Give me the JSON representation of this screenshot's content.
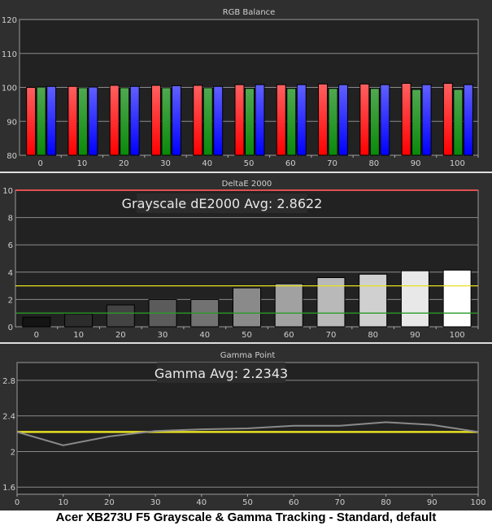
{
  "caption": "Acer XB273U F5 Grayscale & Gamma Tracking - Standard, default",
  "chart_data": [
    {
      "type": "bar",
      "title": "RGB Balance",
      "categories": [
        "0",
        "10",
        "20",
        "30",
        "40",
        "50",
        "60",
        "70",
        "80",
        "90",
        "100"
      ],
      "ylim": [
        80,
        120
      ],
      "yticks": [
        "80",
        "90",
        "100",
        "110",
        "120"
      ],
      "series": [
        {
          "name": "Red",
          "color": "#ff2020",
          "values": [
            100.0,
            100.3,
            100.6,
            100.6,
            100.6,
            100.8,
            100.8,
            101.0,
            101.0,
            101.2,
            101.2
          ]
        },
        {
          "name": "Green",
          "color": "#1a9a1a",
          "values": [
            100.1,
            99.9,
            99.9,
            99.9,
            99.9,
            99.7,
            99.7,
            99.7,
            99.7,
            99.4,
            99.4
          ]
        },
        {
          "name": "Blue",
          "color": "#2020ff",
          "values": [
            100.3,
            100.1,
            100.3,
            100.5,
            100.3,
            100.8,
            100.8,
            100.8,
            100.8,
            100.8,
            100.8
          ]
        }
      ]
    },
    {
      "type": "bar",
      "title": "DeltaE 2000",
      "annotation": "Grayscale dE2000 Avg: 2.8622",
      "categories": [
        "0",
        "10",
        "20",
        "30",
        "40",
        "50",
        "60",
        "70",
        "80",
        "90",
        "100"
      ],
      "ylim": [
        0,
        10
      ],
      "yticks": [
        "0",
        "2",
        "4",
        "6",
        "8",
        "10"
      ],
      "values": [
        0.7,
        0.95,
        1.6,
        2.0,
        2.0,
        2.85,
        3.15,
        3.6,
        3.85,
        4.1,
        4.15
      ],
      "thresholds": [
        {
          "value": 10,
          "color": "#e05050"
        },
        {
          "value": 3,
          "color": "#e8e020"
        },
        {
          "value": 1,
          "color": "#2a9a2a"
        }
      ]
    },
    {
      "type": "line",
      "title": "Gamma Point",
      "annotation": "Gamma Avg: 2.2343",
      "x": [
        0,
        10,
        20,
        30,
        40,
        50,
        60,
        70,
        80,
        90,
        100
      ],
      "xticks": [
        "0",
        "10",
        "20",
        "30",
        "40",
        "50",
        "60",
        "70",
        "80",
        "90",
        "100"
      ],
      "values": [
        2.22,
        2.07,
        2.17,
        2.23,
        2.25,
        2.26,
        2.29,
        2.29,
        2.33,
        2.3,
        2.22
      ],
      "target": 2.22,
      "ylim": [
        1.52,
        3.0
      ],
      "yticks": [
        "1.6",
        "2",
        "2.4",
        "2.8"
      ],
      "ytick_values": [
        1.6,
        2.0,
        2.4,
        2.8
      ]
    }
  ]
}
